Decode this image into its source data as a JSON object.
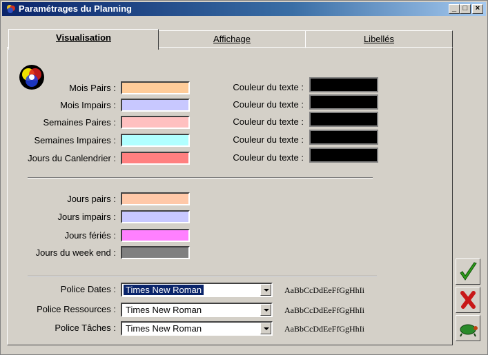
{
  "window": {
    "title": "Paramétrages du Planning",
    "buttons": {
      "minimize": "_",
      "maximize": "□",
      "close": "×"
    }
  },
  "tabs": [
    {
      "label": "Visualisation",
      "active": true
    },
    {
      "label": "Affichage",
      "active": false
    },
    {
      "label": "Libellés",
      "active": false
    }
  ],
  "colors_section": {
    "rows": [
      {
        "label": "Mois Pairs :",
        "color": "#ffcc99",
        "text_label": "Couleur du texte :",
        "text_color": "#000000"
      },
      {
        "label": "Mois Impairs :",
        "color": "#c8c8ff",
        "text_label": "Couleur du texte :",
        "text_color": "#000000"
      },
      {
        "label": "Semaines Paires :",
        "color": "#ffc0c0",
        "text_label": "Couleur du texte :",
        "text_color": "#000000"
      },
      {
        "label": "Semaines Impaires :",
        "color": "#b0ffff",
        "text_label": "Couleur du texte :",
        "text_color": "#000000"
      },
      {
        "label": "Jours du Canlendrier :",
        "color": "#ff8080",
        "text_label": "Couleur du texte :",
        "text_color": "#000000"
      }
    ]
  },
  "days_section": {
    "rows": [
      {
        "label": "Jours pairs :",
        "color": "#ffc8a8"
      },
      {
        "label": "Jours impairs :",
        "color": "#c8c8ff"
      },
      {
        "label": "Jours fériés :",
        "color": "#ff80ff"
      },
      {
        "label": "Jours du week end :",
        "color": "#808080"
      }
    ]
  },
  "fonts_section": {
    "sample_text": "AaBbCcDdEeFfGgHhIi",
    "rows": [
      {
        "label": "Police Dates :",
        "value": "Times New Roman",
        "selected": true
      },
      {
        "label": "Police Ressources :",
        "value": "Times New Roman",
        "selected": false
      },
      {
        "label": "Police Tâches :",
        "value": "Times New Roman",
        "selected": false
      }
    ]
  },
  "side_buttons": [
    "confirm-icon",
    "cancel-icon",
    "help-icon"
  ],
  "colors": {
    "title_start": "#0a246a",
    "title_end": "#a6caf0",
    "confirm": "#2e9c1a",
    "cancel": "#c81818"
  }
}
